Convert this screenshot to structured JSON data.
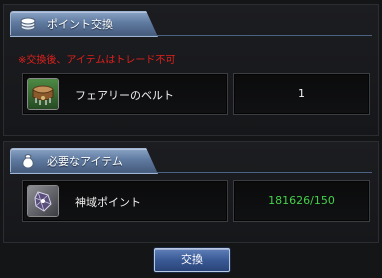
{
  "exchange_section": {
    "tab_label": "ポイント交換",
    "icon": "coins-icon",
    "warning": "※交換後、アイテムはトレード不可",
    "item": {
      "name": "フェアリーのベルト",
      "icon": "belt-icon",
      "quantity": "1"
    }
  },
  "required_section": {
    "tab_label": "必要なアイテム",
    "icon": "pouch-icon",
    "item": {
      "name": "神域ポイント",
      "icon": "shard-icon",
      "amount": "181626/150"
    }
  },
  "exchange_button": {
    "label": "交換"
  },
  "colors": {
    "warning": "#e0201c",
    "amount_ok": "#44d04a",
    "tab_blue": "#5f7aa0"
  }
}
